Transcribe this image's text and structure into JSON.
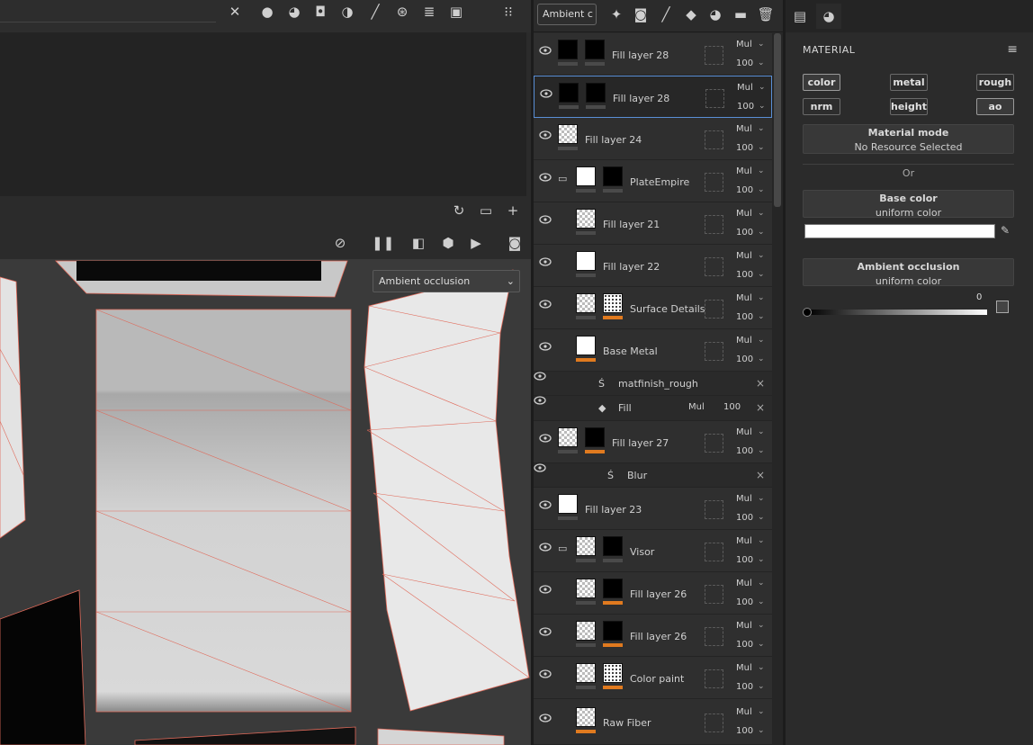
{
  "viewport": {
    "channel_select": "Ambient occlusion"
  },
  "layers_panel": {
    "blend_select": "Ambient c",
    "layers": [
      {
        "name": "Fill layer 28",
        "blend": "Mul",
        "opacity": "100"
      },
      {
        "name": "Fill layer 28",
        "blend": "Mul",
        "opacity": "100",
        "selected": true
      },
      {
        "name": "Fill layer 24",
        "blend": "Mul",
        "opacity": "100"
      },
      {
        "name": "PlateEmpire",
        "blend": "Mul",
        "opacity": "100"
      },
      {
        "name": "Fill layer 21",
        "blend": "Mul",
        "opacity": "100"
      },
      {
        "name": "Fill layer 22",
        "blend": "Mul",
        "opacity": "100"
      },
      {
        "name": "Surface Details",
        "blend": "Mul",
        "opacity": "100"
      },
      {
        "name": "Base Metal",
        "blend": "Mul",
        "opacity": "100"
      },
      {
        "name": "Fill layer 27",
        "blend": "Mul",
        "opacity": "100"
      },
      {
        "name": "Fill layer 23",
        "blend": "Mul",
        "opacity": "100"
      },
      {
        "name": "Visor",
        "blend": "Mul",
        "opacity": "100"
      },
      {
        "name": "Fill layer 26",
        "blend": "Mul",
        "opacity": "100"
      },
      {
        "name": "Fill layer 26",
        "blend": "Mul",
        "opacity": "100"
      },
      {
        "name": "Color paint",
        "blend": "Mul",
        "opacity": "100"
      },
      {
        "name": "Raw Fiber",
        "blend": "Mul",
        "opacity": "100"
      }
    ],
    "effects": {
      "matfinish": "matfinish_rough",
      "fill": "Fill",
      "fill_blend": "Mul",
      "fill_opacity": "100",
      "blur": "Blur"
    }
  },
  "properties": {
    "title": "MATERIAL",
    "channels": [
      "color",
      "metal",
      "rough",
      "nrm",
      "height",
      "ao"
    ],
    "material_mode": {
      "title": "Material mode",
      "value": "No Resource Selected"
    },
    "or_label": "Or",
    "base_color": {
      "title": "Base color",
      "value": "uniform color",
      "color": "#ffffff"
    },
    "ambient_occlusion": {
      "title": "Ambient occlusion",
      "value": "uniform color",
      "slider_value": "0"
    }
  }
}
